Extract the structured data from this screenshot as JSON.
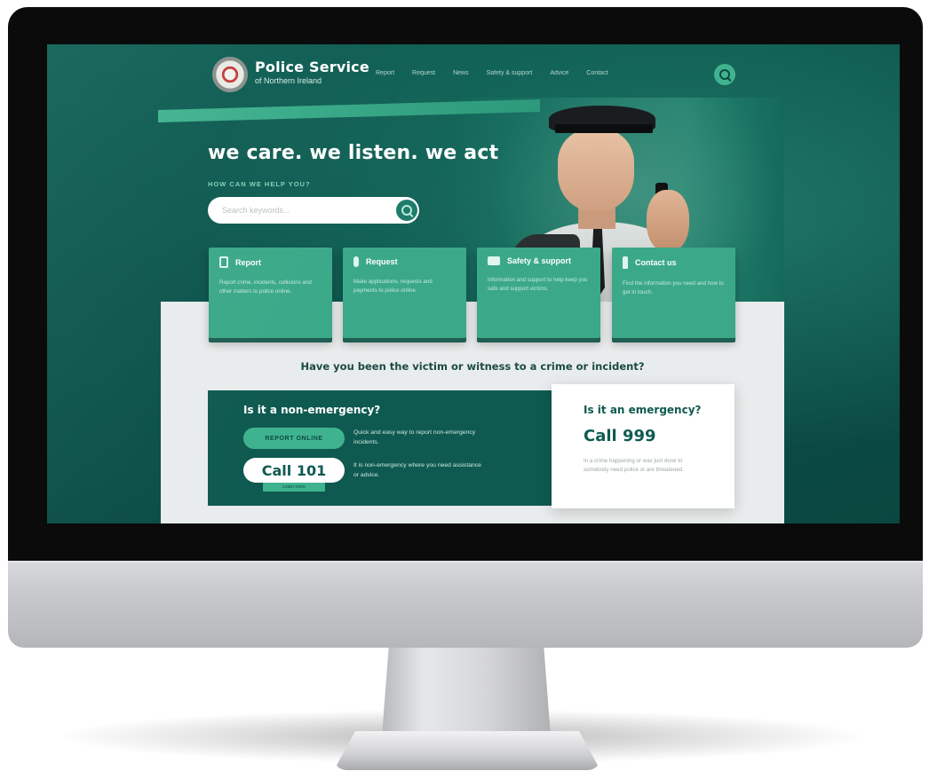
{
  "header": {
    "logo_title": "Police Service",
    "logo_subtitle": "of Northern Ireland",
    "nav": [
      "Report",
      "Request",
      "News",
      "Safety & support",
      "Advice",
      "Contact"
    ]
  },
  "hero": {
    "title": "we care. we listen. we act",
    "help_label": "HOW CAN WE HELP YOU?",
    "search_placeholder": "Search keywords..."
  },
  "cards": [
    {
      "title": "Report",
      "icon": "phone-icon",
      "text": "Report crime, incidents, collisions and other matters to police online."
    },
    {
      "title": "Request",
      "icon": "microphone-icon",
      "text": "Make applications, requests and payments to police online."
    },
    {
      "title": "Safety & support",
      "icon": "briefcase-icon",
      "text": "Information and support to help keep you safe and support victims."
    },
    {
      "title": "Contact us",
      "icon": "bottle-icon",
      "text": "Find the information you need and how to get in touch."
    }
  ],
  "question": "Have you been the victim or witness to a crime or incident?",
  "non_emergency": {
    "title": "Is it a non-emergency?",
    "report_button": "REPORT ONLINE",
    "report_desc": "Quick and easy way to report non-emergency incidents.",
    "call_label": "Call 101",
    "call_tag": "Learn more",
    "call_desc": "It is non-emergency where you need assistance or advice."
  },
  "emergency": {
    "title": "Is it an emergency?",
    "call_label": "Call 999",
    "desc": "In a crime happening or was just done to somebody need police or are threatened."
  },
  "colors": {
    "brand_dark": "#0f5a50",
    "brand_accent": "#3fb38f",
    "panel_light": "#e9ecec"
  }
}
